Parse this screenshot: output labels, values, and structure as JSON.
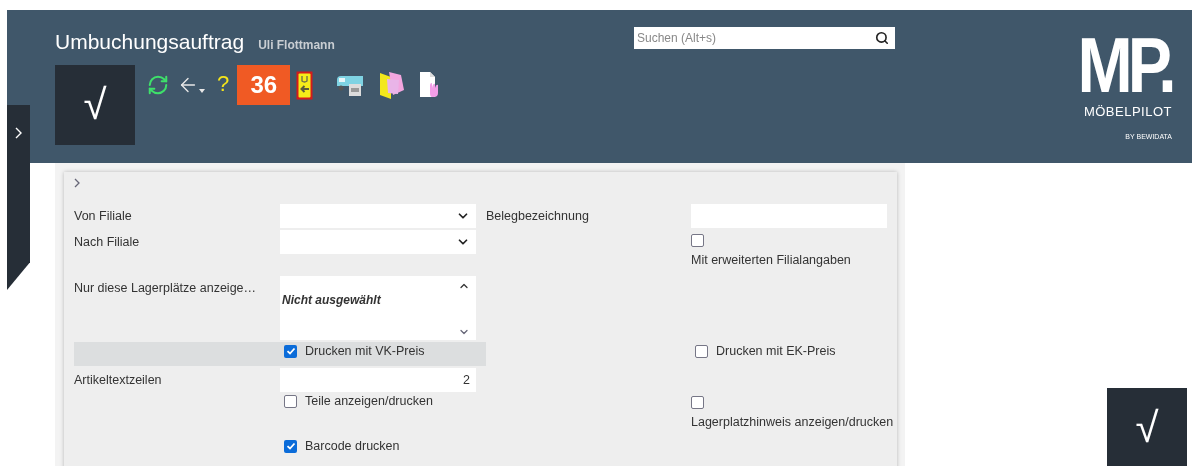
{
  "header": {
    "title": "Umbuchungsauftrag",
    "user": "Uli Flottmann",
    "confirm_symbol": "√",
    "help_symbol": "?",
    "badge": "36",
    "search": {
      "placeholder": "Suchen (Alt+s)"
    },
    "logo": {
      "mark": "MP.",
      "name": "MÖBELPILOT",
      "sub": "BY BEWIDATA"
    }
  },
  "form": {
    "rows": [
      {
        "label": "Von Filiale",
        "control": {
          "kind": "select"
        },
        "right_label": "Belegbezeichnung",
        "right_control": {
          "kind": "text"
        },
        "highlighted": false
      },
      {
        "label": "Nach Filiale",
        "control": {
          "kind": "select"
        },
        "right_control": {
          "kind": "checkbox_below",
          "label": "Mit erweiterten Filialangaben",
          "checked": false
        },
        "highlighted": false
      },
      {
        "label": "Nur diese Lagerplätze anzeige…",
        "control": {
          "kind": "multiselect",
          "value": "Nicht ausgewählt"
        },
        "highlighted": false
      },
      {
        "control": {
          "kind": "checkbox",
          "label": "Drucken mit VK-Preis",
          "checked": true
        },
        "right_control": {
          "kind": "checkbox",
          "label": "Drucken mit EK-Preis",
          "checked": false
        },
        "highlighted": true
      },
      {
        "label": "Artikeltextzeilen",
        "control": {
          "kind": "number",
          "value": "2"
        },
        "highlighted": false
      },
      {
        "control": {
          "kind": "checkbox",
          "label": "Teile anzeigen/drucken",
          "checked": false
        },
        "right_control": {
          "kind": "checkbox_below",
          "label": "Lagerplatzhinweis anzeigen/drucken",
          "checked": false
        },
        "highlighted": false
      },
      {
        "control": {
          "kind": "checkbox",
          "label": "Barcode drucken",
          "checked": true
        },
        "highlighted": false
      }
    ]
  },
  "floating_confirm": "√"
}
